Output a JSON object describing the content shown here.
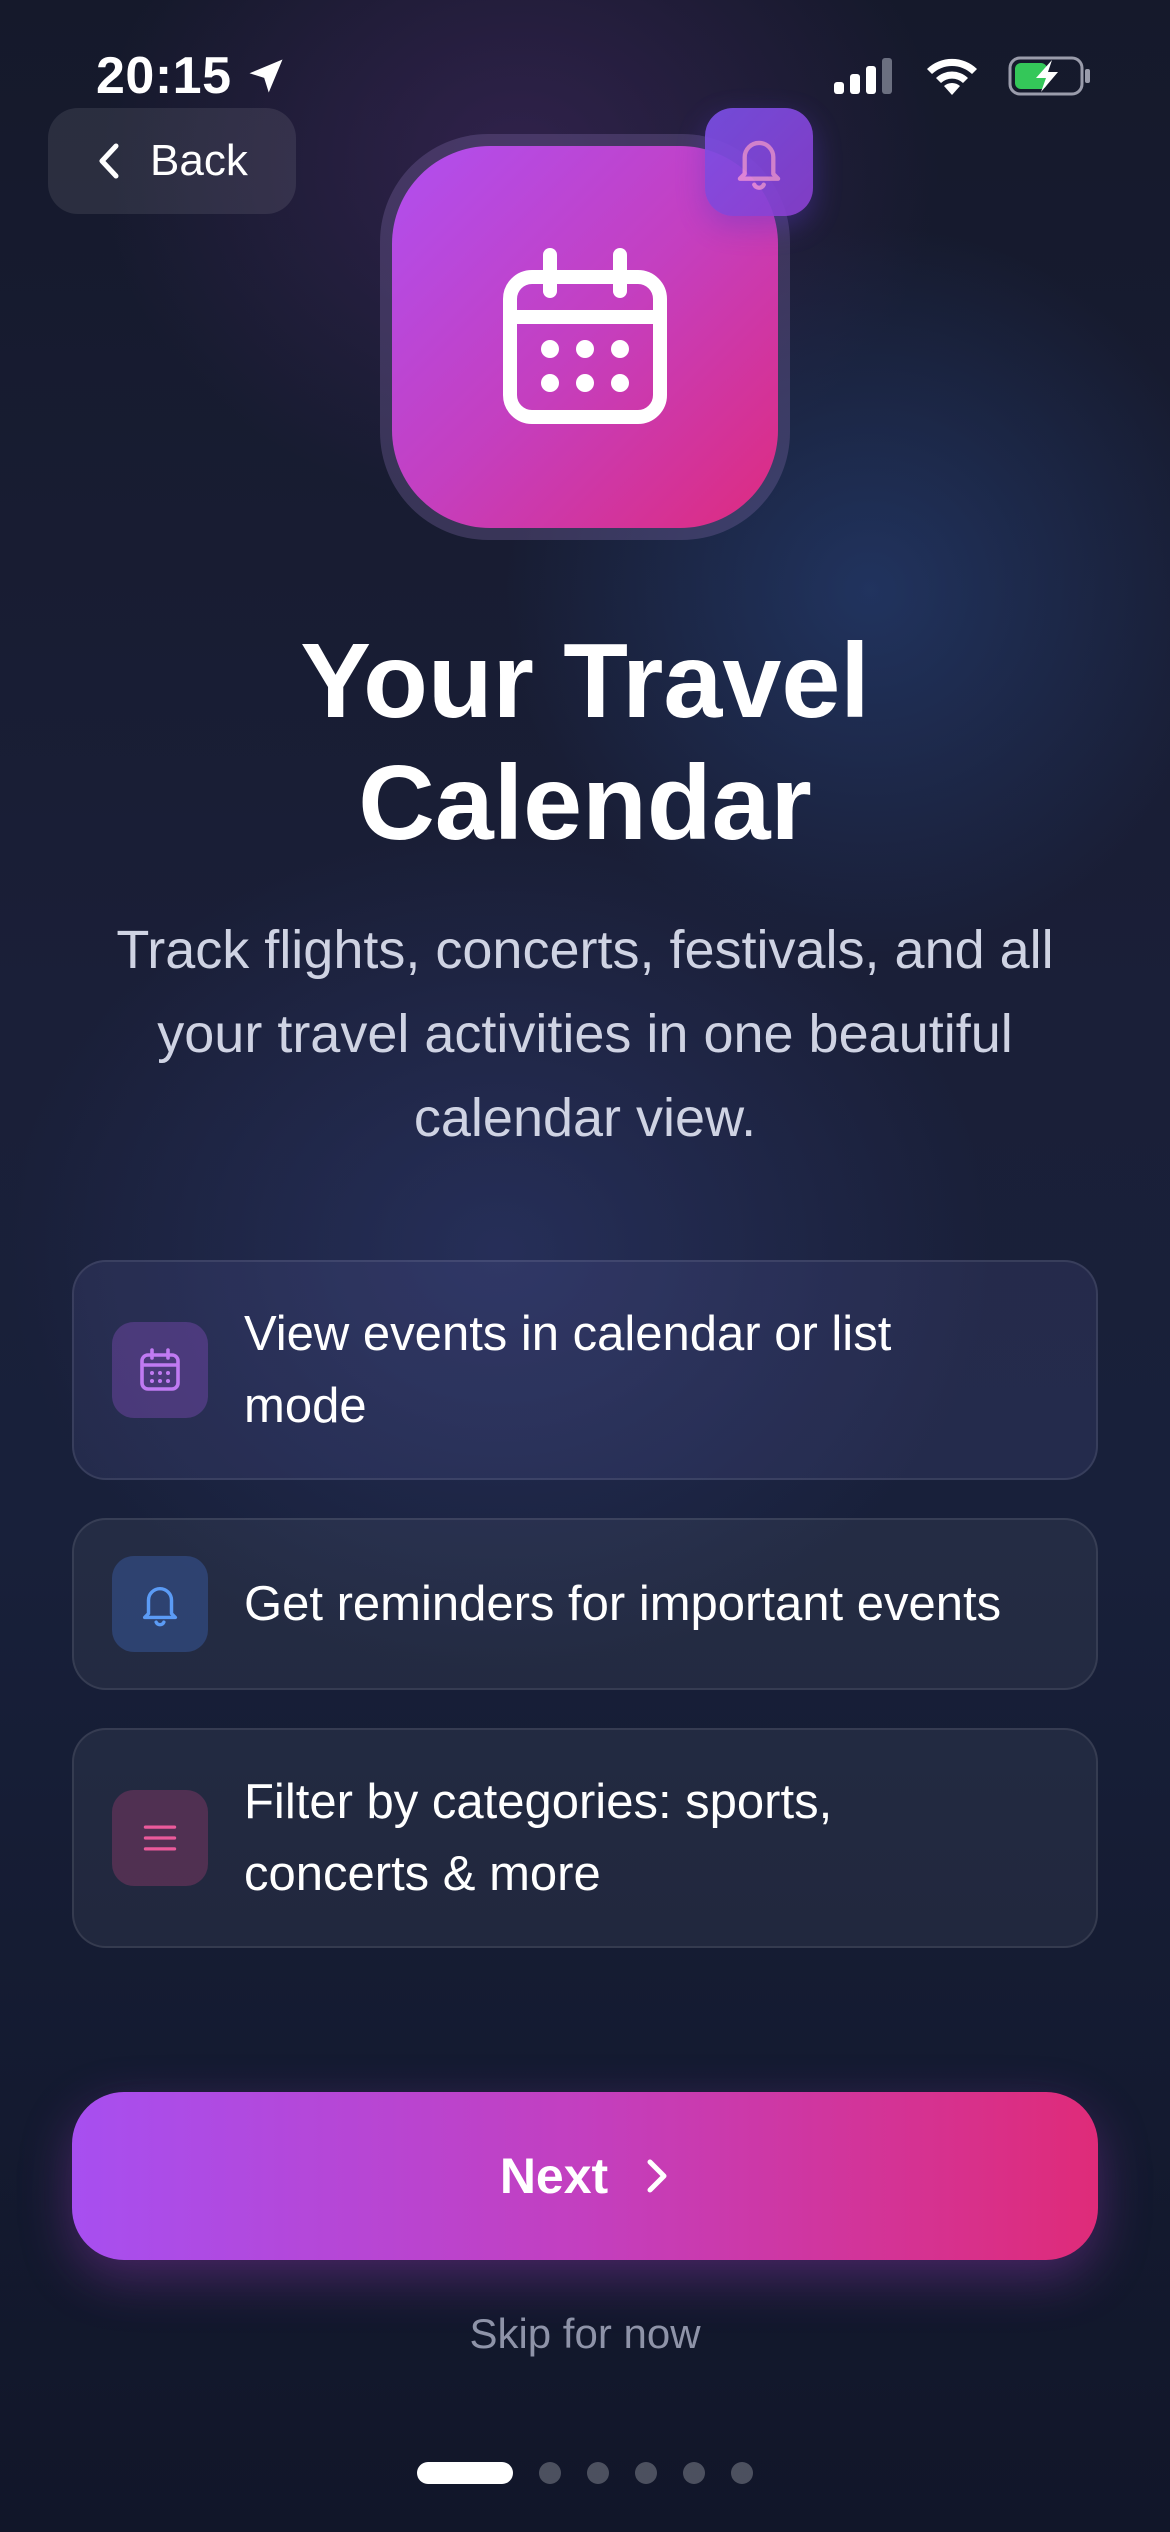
{
  "status_bar": {
    "time": "20:15",
    "battery_color": "#34c759"
  },
  "header": {
    "back_label": "Back"
  },
  "hero": {
    "icon": "calendar-icon",
    "badge_icon": "bell-icon",
    "gradient": [
      "#b04ff0",
      "#de2b7f"
    ]
  },
  "title": "Your Travel\nCalendar",
  "subtitle": "Track flights, concerts, festivals, and all your travel activities in one beautiful calendar view.",
  "features": [
    {
      "icon": "calendar-icon",
      "text": "View events in calendar or list mode",
      "color": "#b463f0"
    },
    {
      "icon": "bell-icon",
      "text": "Get reminders for important events",
      "color": "#4f8ff0"
    },
    {
      "icon": "menu-icon",
      "text": "Filter by categories: sports, concerts & more",
      "color": "#e24a8d"
    }
  ],
  "next_label": "Next",
  "skip_label": "Skip for now",
  "pagination": {
    "current": 1,
    "total": 6
  }
}
